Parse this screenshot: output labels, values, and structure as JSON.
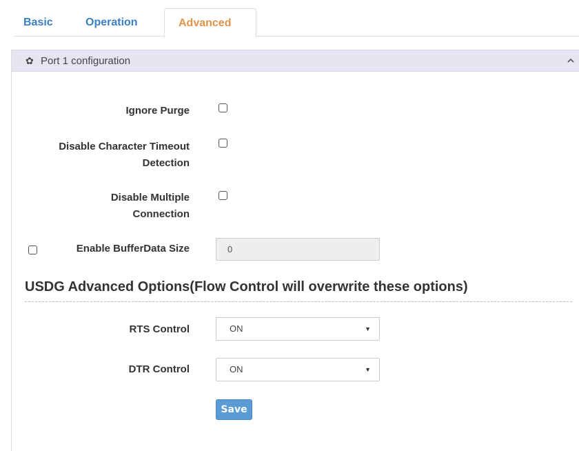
{
  "tabs": [
    {
      "label": "Basic",
      "active": false
    },
    {
      "label": "Operation",
      "active": false
    },
    {
      "label": "Advanced",
      "active": true
    }
  ],
  "panel": {
    "title": "Port 1 configuration",
    "icon": "gear-icon",
    "collapse_icon": "chevron-up-icon"
  },
  "fields": {
    "ignore_purge": {
      "label": "Ignore Purge",
      "checked": false
    },
    "disable_char_timeout": {
      "label_line1": "Disable Character Timeout",
      "label_line2": "Detection",
      "checked": false
    },
    "disable_multiple_connection": {
      "label_line1": "Disable Multiple",
      "label_line2": "Connection",
      "checked": false
    },
    "enable_buffer_data_size": {
      "label": "Enable BufferData Size",
      "checked": false,
      "value": "0"
    }
  },
  "usdg": {
    "title": "USDG Advanced Options(Flow Control will overwrite these options)",
    "rts_control": {
      "label": "RTS Control",
      "value": "ON"
    },
    "dtr_control": {
      "label": "DTR Control",
      "value": "ON"
    }
  },
  "buttons": {
    "save_label": "Save"
  },
  "colors": {
    "tab_link": "#3a7fc1",
    "tab_active": "#e0934a",
    "panel_header_bg": "#e6e5f2",
    "save_button": "#5b9bd5"
  }
}
